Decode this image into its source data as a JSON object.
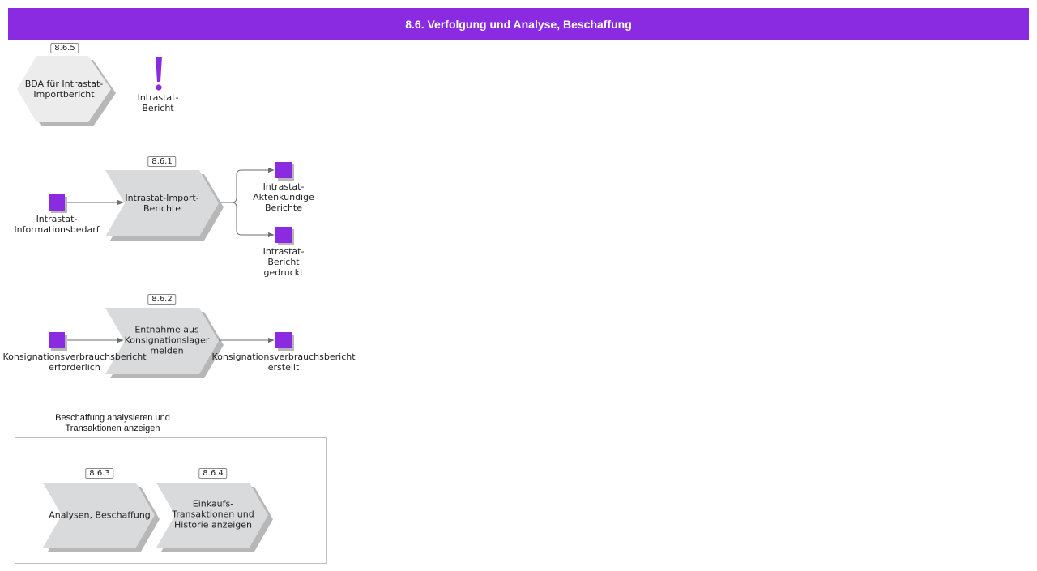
{
  "title": "8.6. Verfolgung und Analyse, Beschaffung",
  "colors": {
    "header": "#8a2be2",
    "event": "#8a2be2",
    "process_fill": "#d9dadc",
    "interface_fill": "#ececec",
    "shadow": "#b7b7b7"
  },
  "top_row": {
    "interface": {
      "badge": "8.6.5",
      "label": "BDA für Intrastat-\nImportbericht"
    },
    "alert": {
      "symbol": "!",
      "label": "Intrastat-\nBericht"
    }
  },
  "flow1": {
    "start_event": "Intrastat-\nInformationsbedarf",
    "process": {
      "badge": "8.6.1",
      "label": "Intrastat-Import-\nBerichte"
    },
    "end_event_1": "Intrastat-\nAktenkundige\nBerichte",
    "end_event_2": "Intrastat-\nBericht\ngedruckt"
  },
  "flow2": {
    "start_event": "Konsignationsverbrauchsbericht\nerforderlich",
    "process": {
      "badge": "8.6.2",
      "label": "Entnahme aus\nKonsignationslager\nmelden"
    },
    "end_event": "Konsignationsverbrauchsbericht\nerstellt"
  },
  "group": {
    "title": "Beschaffung analysieren und\nTransaktionen anzeigen",
    "process_a": {
      "badge": "8.6.3",
      "label": "Analysen, Beschaffung"
    },
    "process_b": {
      "badge": "8.6.4",
      "label": "Einkaufs-\nTransaktionen und\nHistorie anzeigen"
    }
  }
}
